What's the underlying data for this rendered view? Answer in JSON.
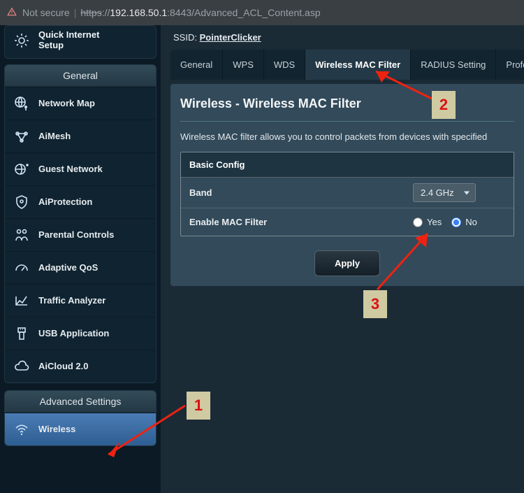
{
  "addressbar": {
    "warning": "Not secure",
    "scheme": "https",
    "ip": "192.168.50.1",
    "port": ":8443",
    "path": "/Advanced_ACL_Content.asp"
  },
  "sidebar": {
    "quick_setup_l1": "Quick Internet",
    "quick_setup_l2": "Setup",
    "general": {
      "title": "General",
      "items": [
        {
          "label": "Network Map"
        },
        {
          "label": "AiMesh"
        },
        {
          "label": "Guest Network"
        },
        {
          "label": "AiProtection"
        },
        {
          "label": "Parental Controls"
        },
        {
          "label": "Adaptive QoS"
        },
        {
          "label": "Traffic Analyzer"
        },
        {
          "label": "USB Application"
        },
        {
          "label": "AiCloud 2.0"
        }
      ]
    },
    "advanced": {
      "title": "Advanced Settings",
      "items": [
        {
          "label": "Wireless"
        }
      ]
    }
  },
  "ssid": {
    "label": "SSID:",
    "value": "PointerClicker"
  },
  "tabs": [
    {
      "label": "General"
    },
    {
      "label": "WPS"
    },
    {
      "label": "WDS"
    },
    {
      "label": "Wireless MAC Filter"
    },
    {
      "label": "RADIUS Setting"
    },
    {
      "label": "Profes"
    }
  ],
  "page": {
    "title": "Wireless - Wireless MAC Filter",
    "desc": "Wireless MAC filter allows you to control packets from devices with specified ",
    "section_head": "Basic Config",
    "band_label": "Band",
    "band_value": "2.4 GHz",
    "enable_label": "Enable MAC Filter",
    "yes": "Yes",
    "no": "No",
    "apply": "Apply"
  },
  "annotations": {
    "one": "1",
    "two": "2",
    "three": "3"
  }
}
